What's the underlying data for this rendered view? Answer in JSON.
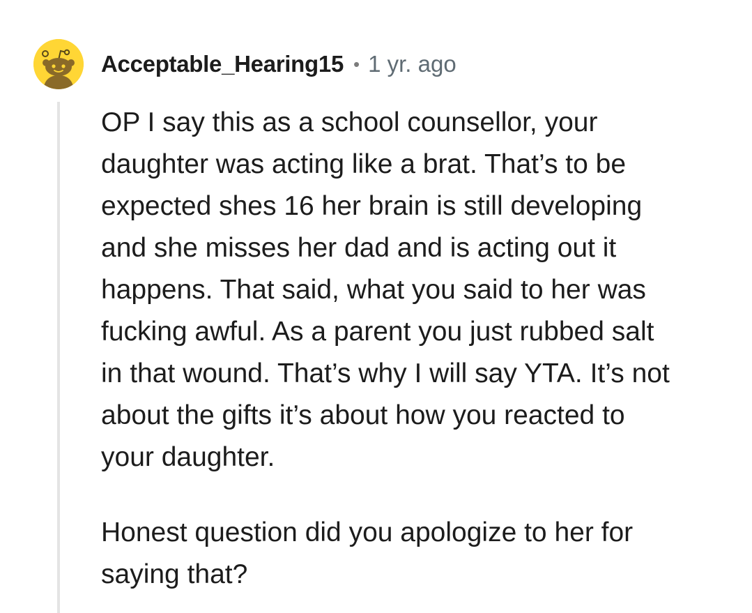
{
  "comment": {
    "author": "Acceptable_Hearing15",
    "separator": "•",
    "timestamp": "1 yr. ago",
    "avatar_icon": "snoo-avatar-icon",
    "avatar_color": "#ffd635",
    "paragraphs": [
      {
        "lines": [
          "OP I say this as a school counsellor, your",
          "daughter was acting like a brat. That’s to be",
          "expected shes 16 her brain is still developing",
          "and she misses her dad and is acting out it",
          "happens. That said, what you said to her was",
          "fucking awful. As a parent you just rubbed salt",
          "in that wound. That’s why I will say YTA. It’s not",
          "about the gifts it’s about how you reacted to",
          "your daughter."
        ]
      },
      {
        "lines": [
          "Honest question did you apologize to her for",
          "saying that?"
        ]
      }
    ]
  }
}
